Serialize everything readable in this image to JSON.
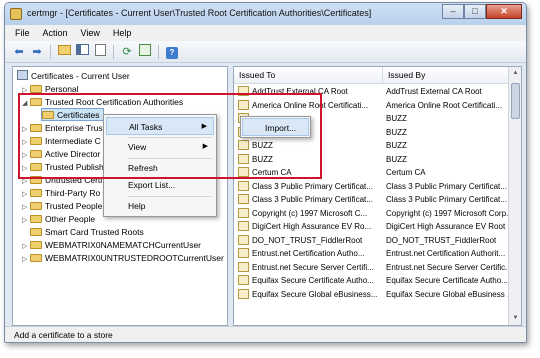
{
  "window": {
    "title": "certmgr - [Certificates - Current User\\Trusted Root Certification Authorities\\Certificates]"
  },
  "menu": {
    "items": [
      "File",
      "Action",
      "View",
      "Help"
    ]
  },
  "tree": {
    "root": "Certificates - Current User",
    "items": [
      {
        "label": "Personal",
        "expander": "▷"
      },
      {
        "label": "Trusted Root Certification Authorities",
        "expander": "◢"
      },
      {
        "label": "Certificates",
        "expander": ""
      },
      {
        "label": "Enterprise Trus",
        "expander": "▷"
      },
      {
        "label": "Intermediate C",
        "expander": "▷"
      },
      {
        "label": "Active Director",
        "expander": "▷"
      },
      {
        "label": "Trusted Publish",
        "expander": "▷"
      },
      {
        "label": "Untrusted Certi",
        "expander": "▷"
      },
      {
        "label": "Third-Party Ro",
        "expander": "▷"
      },
      {
        "label": "Trusted People",
        "expander": "▷"
      },
      {
        "label": "Other People",
        "expander": "▷"
      },
      {
        "label": "Smart Card Trusted Roots",
        "expander": ""
      },
      {
        "label": "WEBMATRIX0NAMEMATCHCurrentUser",
        "expander": "▷"
      },
      {
        "label": "WEBMATRIX0UNTRUSTEDROOTCurrentUser",
        "expander": "▷"
      }
    ]
  },
  "list": {
    "columns": [
      "Issued To",
      "Issued By"
    ],
    "rows": [
      [
        "AddTrust External CA Root",
        "AddTrust External CA Root"
      ],
      [
        "America Online Root Certificati...",
        "America Online Root Certificati..."
      ],
      [
        "",
        "BUZZ"
      ],
      [
        "",
        "BUZZ"
      ],
      [
        "BUZZ",
        "BUZZ"
      ],
      [
        "BUZZ",
        "BUZZ"
      ],
      [
        "Certum CA",
        "Certum CA"
      ],
      [
        "Class 3 Public Primary Certificat...",
        "Class 3 Public Primary Certificat..."
      ],
      [
        "Class 3 Public Primary Certificat...",
        "Class 3 Public Primary Certificat..."
      ],
      [
        "Copyright (c) 1997 Microsoft C...",
        "Copyright (c) 1997 Microsoft Corp."
      ],
      [
        "DigiCert High Assurance EV Ro...",
        "DigiCert High Assurance EV Root ..."
      ],
      [
        "DO_NOT_TRUST_FiddlerRoot",
        "DO_NOT_TRUST_FiddlerRoot"
      ],
      [
        "Entrust.net Certification Autho...",
        "Entrust.net Certification Authorit..."
      ],
      [
        "Entrust.net Secure Server Certifi...",
        "Entrust.net Secure Server Certific..."
      ],
      [
        "Equifax Secure Certificate Autho...",
        "Equifax Secure Certificate Autho..."
      ],
      [
        "Equifax Secure Global eBusiness...",
        "Equifax Secure Global eBusiness ..."
      ]
    ]
  },
  "context_menu": {
    "items": [
      "All Tasks",
      "View",
      "Refresh",
      "Export List...",
      "Help"
    ],
    "submenu_items": [
      "Import..."
    ]
  },
  "status": {
    "text": "Add a certificate to a store"
  },
  "colors": {
    "highlight_box": "#d0132c",
    "selected_row": "#cce4f7",
    "menu_hover": "#d9e7f7"
  }
}
